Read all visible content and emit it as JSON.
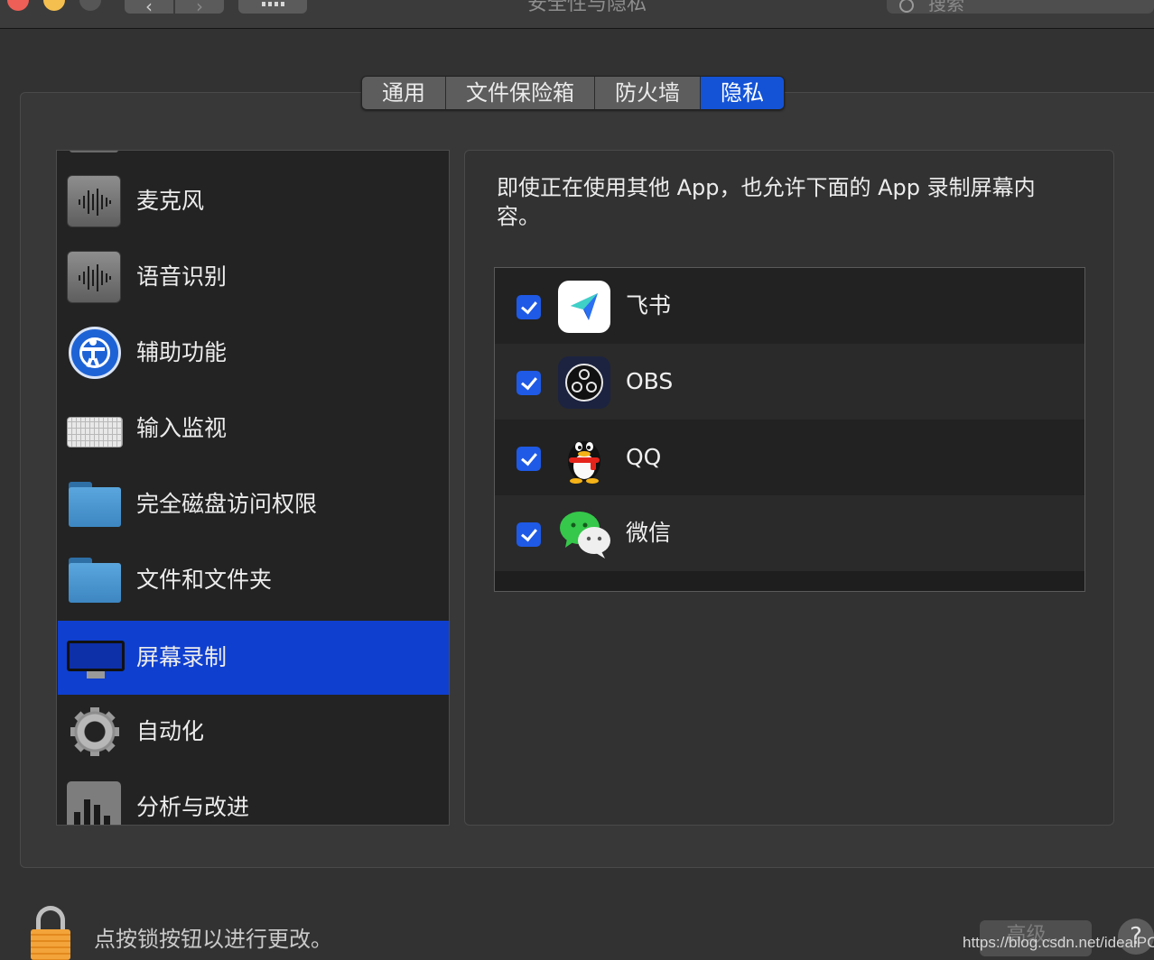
{
  "window": {
    "title": "安全性与隐私",
    "search_placeholder": "搜索",
    "back_glyph": "‹",
    "forward_glyph": "›"
  },
  "tabs": [
    {
      "label": "通用",
      "active": false
    },
    {
      "label": "文件保险箱",
      "active": false
    },
    {
      "label": "防火墙",
      "active": false
    },
    {
      "label": "隐私",
      "active": true
    }
  ],
  "sidebar": {
    "items": [
      {
        "label": "麦克风",
        "icon": "microphone-waveform-icon"
      },
      {
        "label": "语音识别",
        "icon": "speech-waveform-icon"
      },
      {
        "label": "辅助功能",
        "icon": "accessibility-icon"
      },
      {
        "label": "输入监视",
        "icon": "keyboard-icon"
      },
      {
        "label": "完全磁盘访问权限",
        "icon": "folder-icon"
      },
      {
        "label": "文件和文件夹",
        "icon": "folder-icon"
      },
      {
        "label": "屏幕录制",
        "icon": "monitor-icon",
        "selected": true
      },
      {
        "label": "自动化",
        "icon": "gear-icon"
      },
      {
        "label": "分析与改进",
        "icon": "bar-chart-icon"
      }
    ]
  },
  "detail": {
    "description": "即使正在使用其他 App，也允许下面的 App 录制屏幕内容。",
    "apps": [
      {
        "name": "飞书",
        "checked": true,
        "icon": "feishu-icon"
      },
      {
        "name": "OBS",
        "checked": true,
        "icon": "obs-icon"
      },
      {
        "name": "QQ",
        "checked": true,
        "icon": "qq-penguin-icon"
      },
      {
        "name": "微信",
        "checked": true,
        "icon": "wechat-icon"
      }
    ]
  },
  "footer": {
    "lock_text": "点按锁按钮以进行更改。",
    "advanced_label": "高级...",
    "help_label": "?",
    "watermark": "https://blog.csdn.net/idealPC"
  },
  "colors": {
    "accent": "#1453d6",
    "selection": "#0f3fcf",
    "checkbox": "#1f5ae6"
  }
}
